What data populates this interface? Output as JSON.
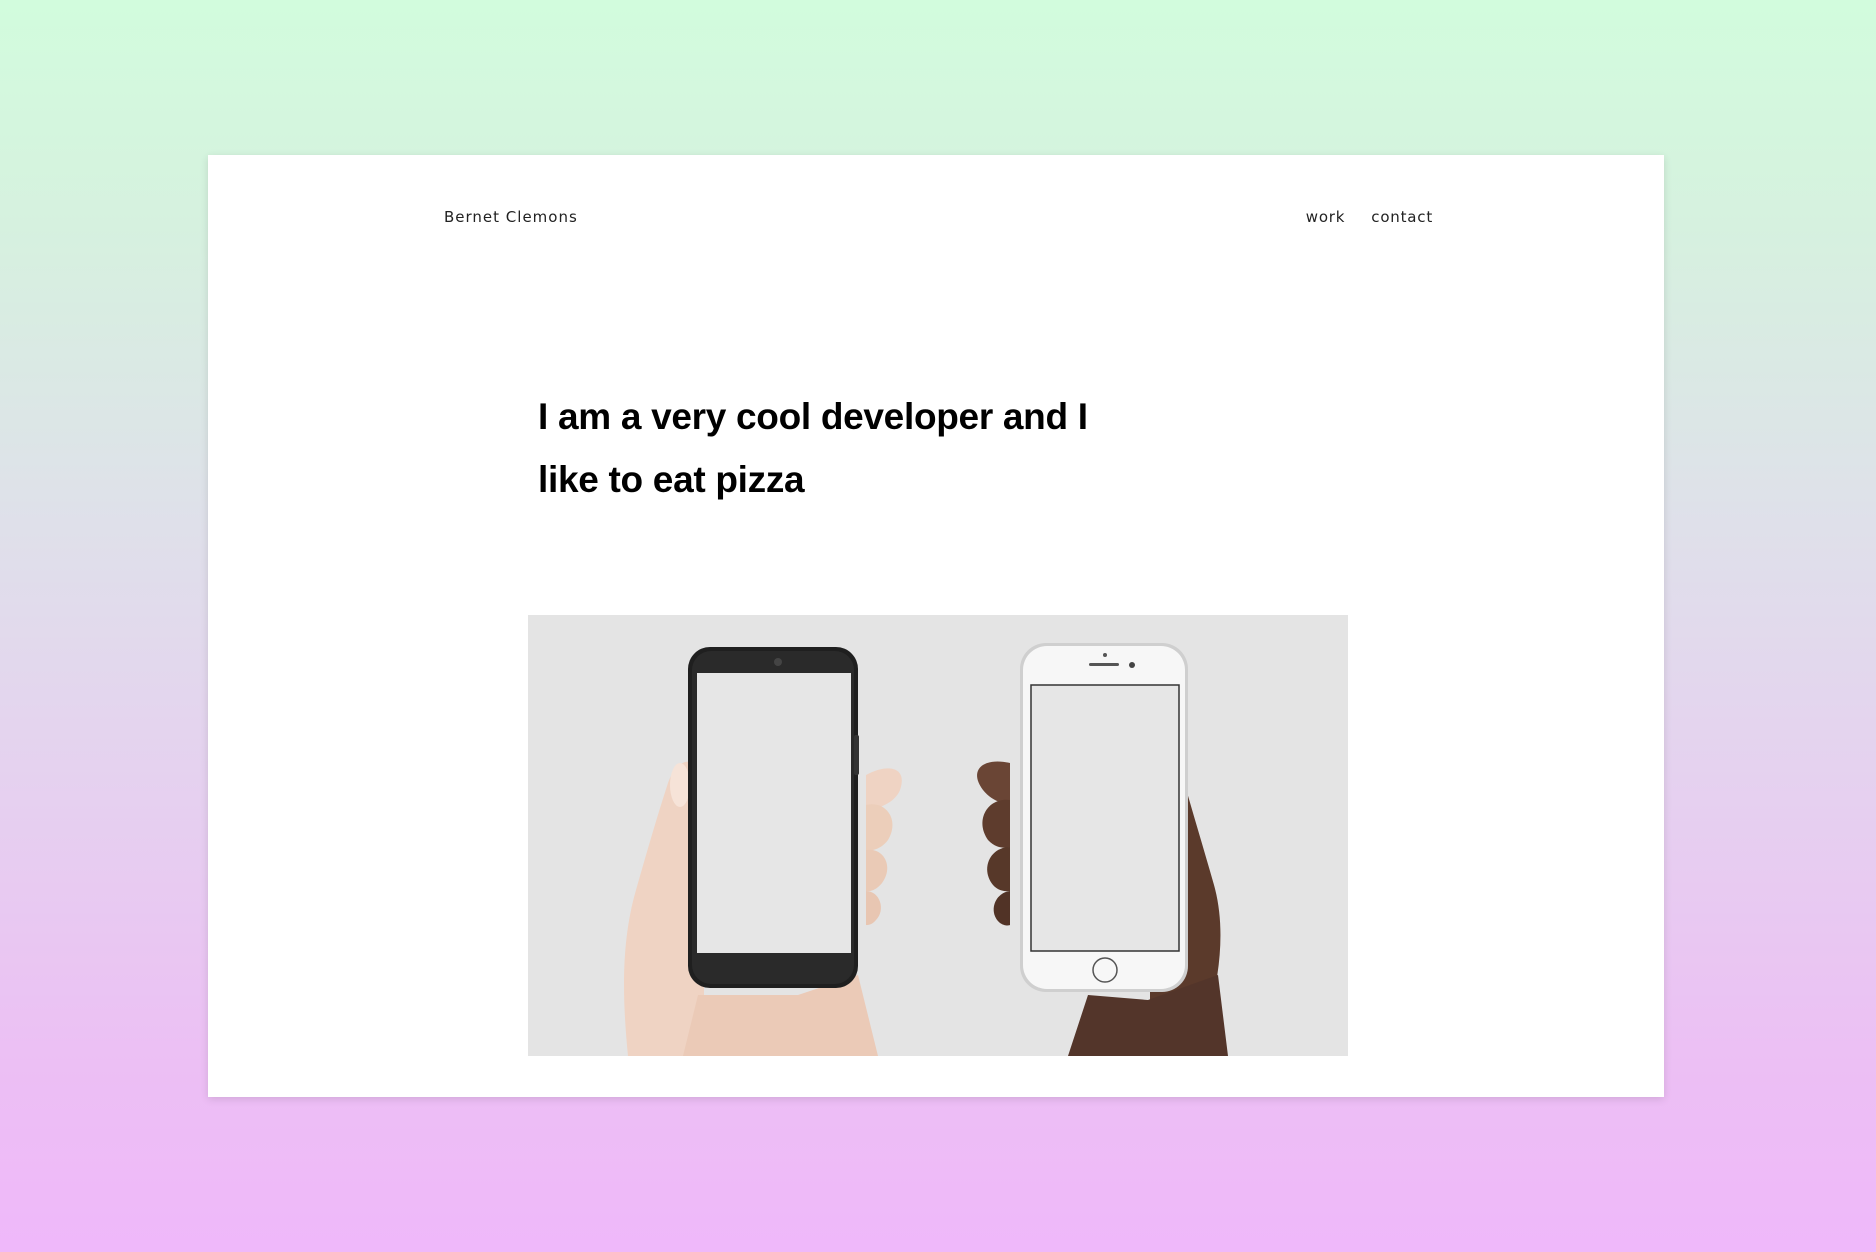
{
  "header": {
    "brand": "Bernet Clemons",
    "nav": [
      {
        "label": "work"
      },
      {
        "label": "contact"
      }
    ]
  },
  "main": {
    "headline": "I am a very cool developer and I like to eat pizza"
  },
  "colors": {
    "background_top": "#d2fcdd",
    "background_bottom": "#efb8fa",
    "card": "#ffffff",
    "hero_background": "#e4e4e4"
  }
}
